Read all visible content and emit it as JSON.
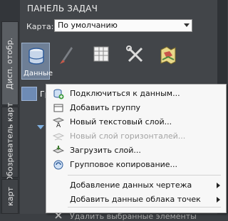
{
  "panel": {
    "title": "ПАНЕЛЬ ЗАДАЧ"
  },
  "side_tabs": [
    {
      "label": "Дисп. отобр."
    },
    {
      "label": "Обозреватель карт"
    },
    {
      "label": "карт"
    }
  ],
  "map_row": {
    "label": "Карта:",
    "selected": "По умолчанию"
  },
  "toolbar": {
    "data_label": "Данные"
  },
  "subbar": {
    "text": "Гру"
  },
  "context_menu": {
    "items": [
      {
        "label": "Подключиться к данным...",
        "icon": "connect-data-icon",
        "disabled": false
      },
      {
        "label": "Добавить группу",
        "icon": "add-group-icon",
        "disabled": false
      },
      {
        "label": "Новый текстовый слой...",
        "icon": "text-layer-icon",
        "disabled": false
      },
      {
        "label": "Новый слой горизонталей...",
        "icon": "contour-layer-icon",
        "disabled": true
      },
      {
        "label": "Загрузить слой...",
        "icon": "load-layer-icon",
        "disabled": false
      },
      {
        "label": "Групповое копирование...",
        "icon": "bulk-copy-icon",
        "disabled": false
      },
      {
        "label": "Добавление данных чертежа",
        "submenu": true
      },
      {
        "label": "Добавить данные облака точек",
        "submenu": true
      },
      {
        "label": "Удалить выбранные элементы",
        "icon": "delete-icon",
        "disabled": true
      }
    ]
  }
}
